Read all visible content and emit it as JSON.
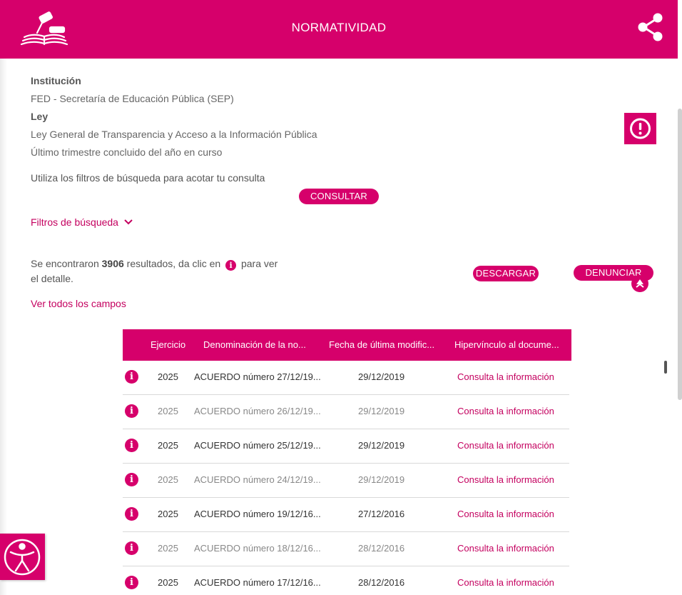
{
  "header": {
    "title": "NORMATIVIDAD",
    "logo_icon": "gavel-book-icon",
    "share_icon": "share-icon",
    "color": "#d6006b"
  },
  "institution": {
    "label": "Institución",
    "value": "FED - Secretaría de Educación Pública (SEP)"
  },
  "law": {
    "label": "Ley",
    "value": "Ley General de Transparencia y Acceso a la Información Pública",
    "period": "Último trimestre concluido del año en curso"
  },
  "filters": {
    "hint": "Utiliza los filtros de búsqueda para acotar tu consulta",
    "consult_label": "CONSULTAR",
    "toggle_label": "Filtros de búsqueda"
  },
  "results": {
    "prefix": "Se encontraron",
    "count": "3906",
    "middle": "resultados, da clic en",
    "suffix": "para ver el detalle.",
    "download_label": "DESCARGAR",
    "report_label": "DENUNCIAR",
    "view_all_label": "Ver todos los campos"
  },
  "table": {
    "headers": [
      "Ejercicio",
      "Denominación de la no...",
      "Fecha de última modific...",
      "Hipervínculo al docume..."
    ],
    "rows": [
      {
        "year": "2025",
        "name": "ACUERDO número 27/12/19...",
        "date": "29/12/2019",
        "link": "Consulta la información"
      },
      {
        "year": "2025",
        "name": "ACUERDO número 26/12/19...",
        "date": "29/12/2019",
        "link": "Consulta la información"
      },
      {
        "year": "2025",
        "name": "ACUERDO número 25/12/19...",
        "date": "29/12/2019",
        "link": "Consulta la información"
      },
      {
        "year": "2025",
        "name": "ACUERDO número 24/12/19...",
        "date": "29/12/2019",
        "link": "Consulta la información"
      },
      {
        "year": "2025",
        "name": "ACUERDO número 19/12/16...",
        "date": "27/12/2016",
        "link": "Consulta la información"
      },
      {
        "year": "2025",
        "name": "ACUERDO número 18/12/16...",
        "date": "28/12/2016",
        "link": "Consulta la información"
      },
      {
        "year": "2025",
        "name": "ACUERDO número 17/12/16...",
        "date": "28/12/2016",
        "link": "Consulta la información"
      }
    ]
  }
}
